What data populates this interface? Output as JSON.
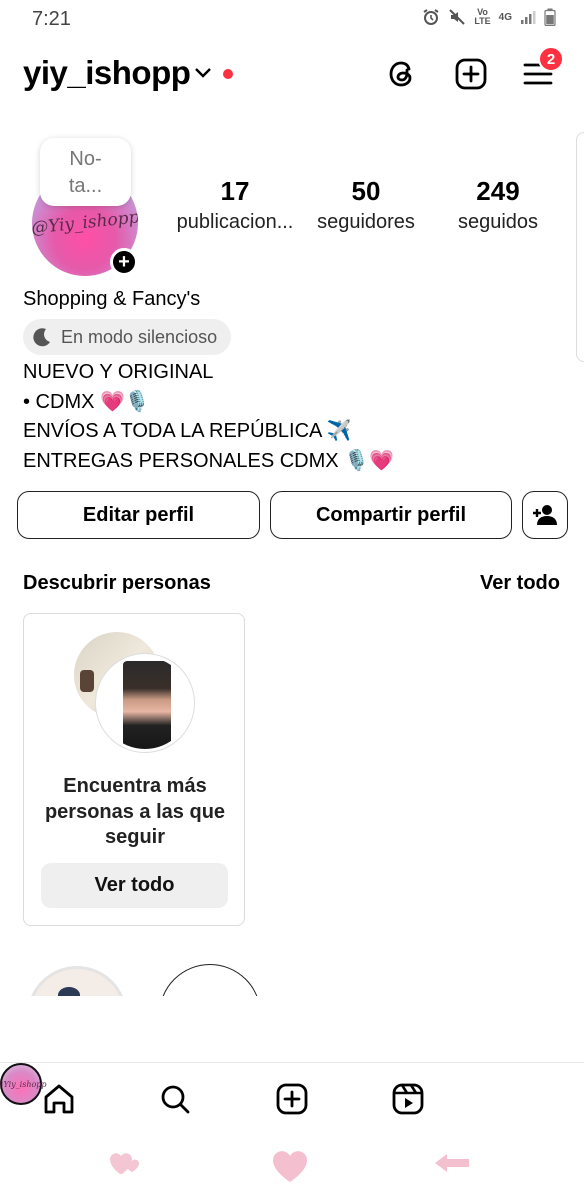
{
  "status_bar": {
    "time": "7:21",
    "network_top": "Vo",
    "network_bottom": "LTE",
    "network_gen": "4G"
  },
  "header": {
    "username": "yiy_ishopp",
    "menu_badge": "2"
  },
  "profile": {
    "note_text": "No-ta...",
    "avatar_logo_text": "@Yiy_ishopp",
    "stats": [
      {
        "value": "17",
        "label": "publicacion..."
      },
      {
        "value": "50",
        "label": "seguidores"
      },
      {
        "value": "249",
        "label": "seguidos"
      }
    ],
    "display_name": "Shopping & Fancy's",
    "quiet_mode": "En modo silencioso",
    "bio_lines": [
      "NUEVO Y ORIGINAL",
      "• CDMX 💗🎙️",
      "ENVÍOS A TODA LA REPÚBLICA ✈️",
      "ENTREGAS PERSONALES CDMX 🎙️💗"
    ]
  },
  "buttons": {
    "edit": "Editar perfil",
    "share": "Compartir perfil"
  },
  "discover": {
    "title": "Descubrir personas",
    "see_all": "Ver todo",
    "card_text": "Encuentra más personas a las que seguir",
    "card_button": "Ver todo"
  },
  "colors": {
    "badge": "#ff3040",
    "chip_bg": "#efefef",
    "border": "#dbdbdb"
  }
}
